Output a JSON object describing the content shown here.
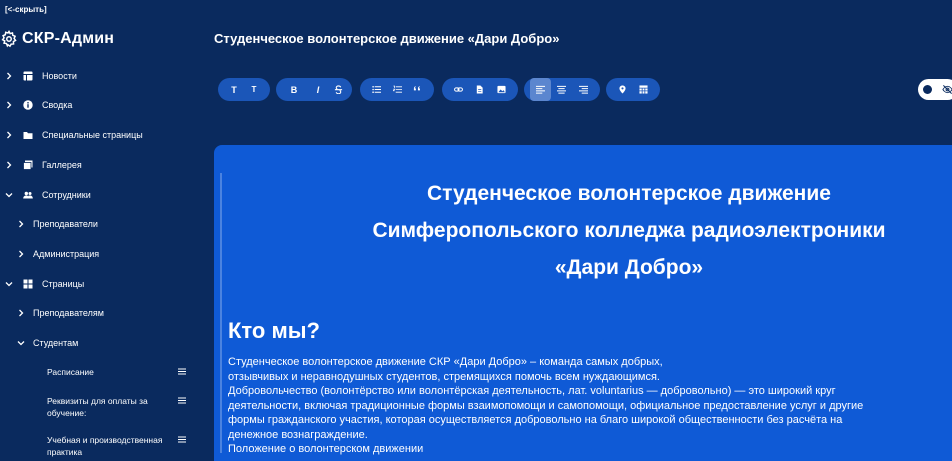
{
  "sidebar": {
    "hide_label": "[<-скрыть]",
    "brand": "СКР-Админ",
    "items": [
      {
        "label": "Новости",
        "icon": "table-icon"
      },
      {
        "label": "Сводка",
        "icon": "info-icon"
      },
      {
        "label": "Специальные страницы",
        "icon": "folder-icon"
      },
      {
        "label": "Галлерея",
        "icon": "gallery-icon"
      },
      {
        "label": "Сотрудники",
        "icon": "people-icon"
      },
      {
        "label": "Преподаватели"
      },
      {
        "label": "Администрация"
      },
      {
        "label": "Страницы",
        "icon": "grid-icon"
      },
      {
        "label": "Преподавателям"
      },
      {
        "label": "Студентам"
      },
      {
        "label": "Расписание"
      },
      {
        "label": "Реквизиты для оплаты за обучение:"
      },
      {
        "label": "Учебная и производственная практика"
      }
    ]
  },
  "main": {
    "title": "Студенческое волонтерское движение «Дари Добро»"
  },
  "toolbar": {
    "heading1": "T",
    "heading2": "T",
    "bold": "B",
    "italic": "I"
  },
  "editor": {
    "heading_lines": [
      "Студенческое волонтерское движение",
      "Симферопольского колледжа радиоэлектроники",
      "«Дари Добро»"
    ],
    "section_title": "Кто мы?",
    "paragraph_lines": [
      "Студенческое волонтерское движение СКР «Дари Добро» – команда самых добрых,",
      "отзывчивых и неравнодушных студентов, стремящихся помочь всем нуждающимся.",
      "Добровольчество (волонтёрство или волонтёрская деятельность, лат. voluntarius — добровольно) — это широкий круг",
      "деятельности, включая традиционные формы взаимопомощи и самопомощи, официальное предоставление услуг и другие",
      "формы гражданского участия, которая осуществляется добровольно на благо широкой общественности без расчёта на",
      "денежное вознаграждение.",
      "Положение о волонтерском движении"
    ]
  },
  "colors": {
    "background": "#0a2a5e",
    "toolbar_group": "#1b56b8",
    "toolbar_active": "#5b86cf",
    "editor": "#0f5ad6"
  }
}
